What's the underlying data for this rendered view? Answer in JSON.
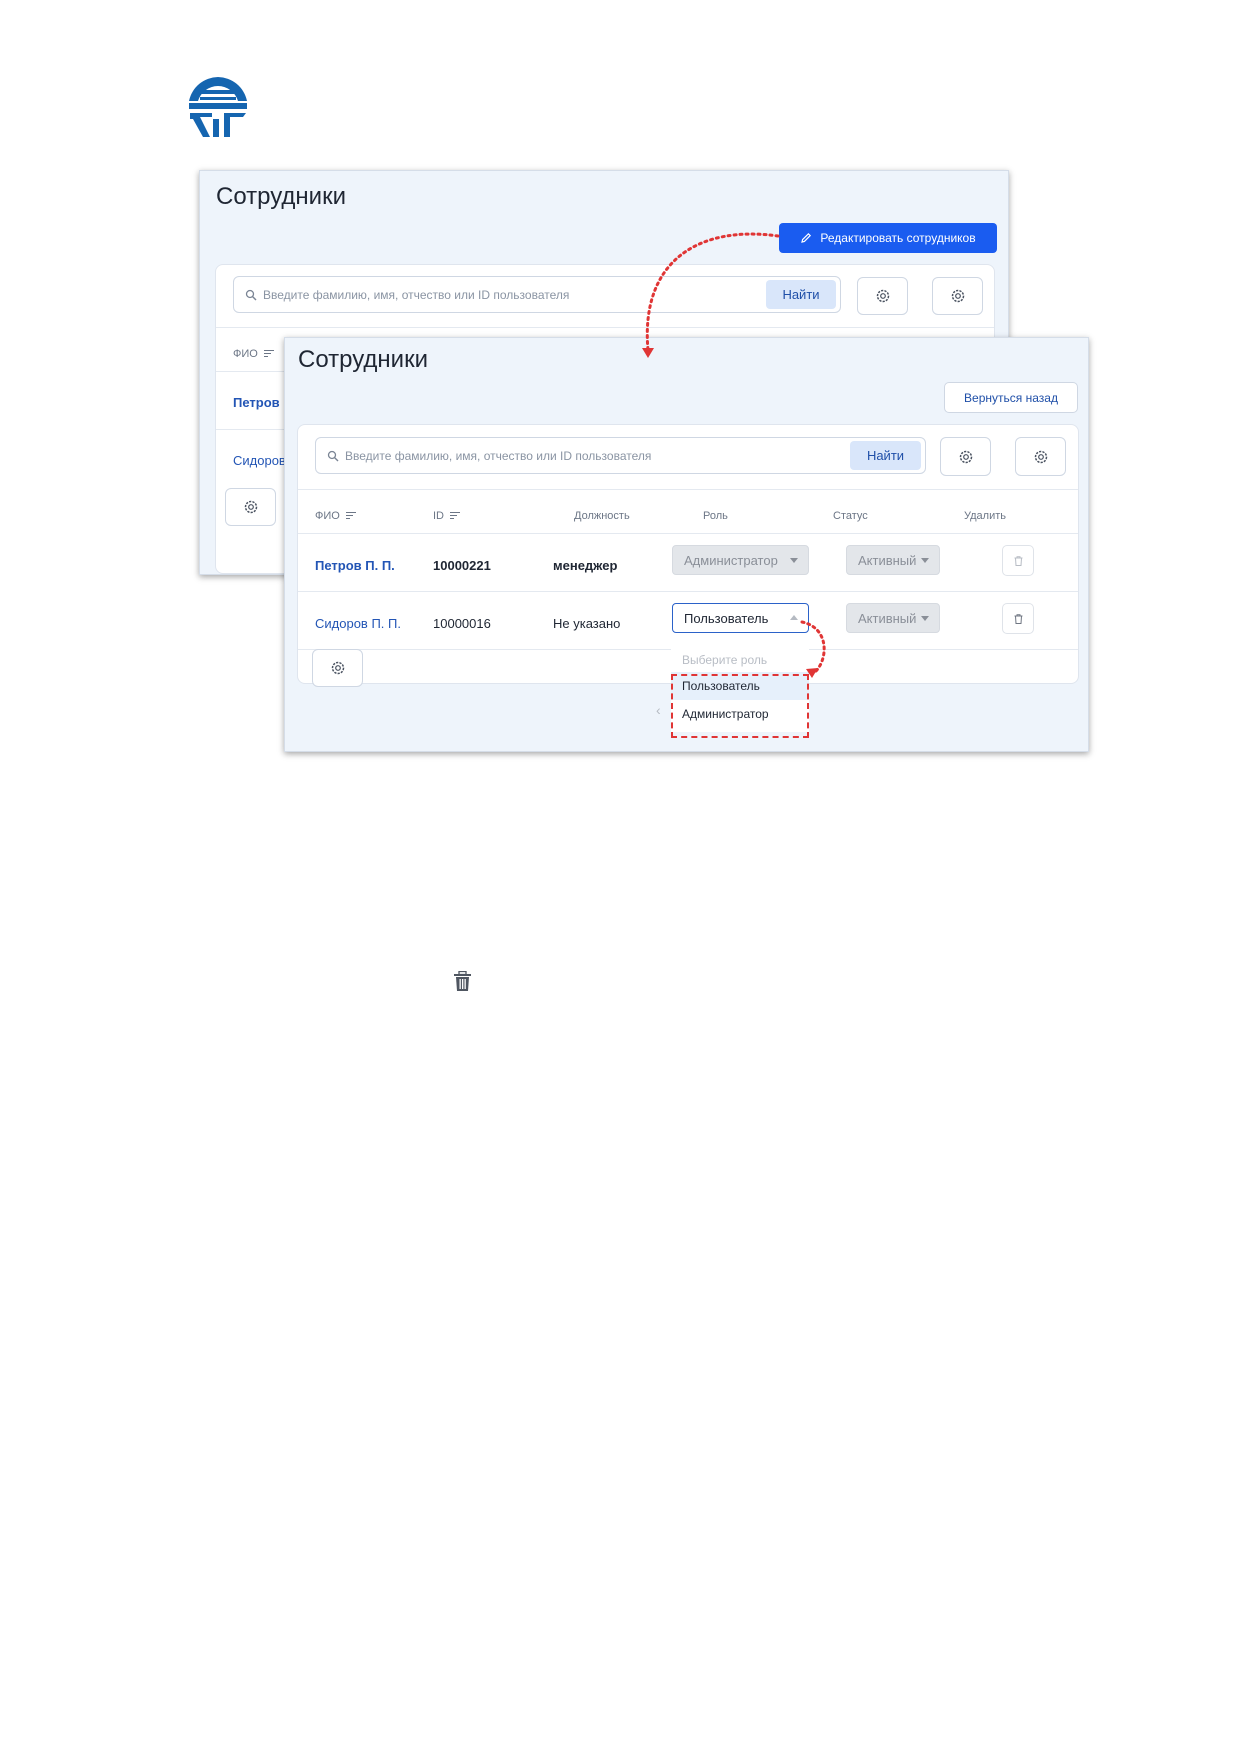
{
  "colors": {
    "accent": "#1a5cf0",
    "logo": "#1565b0",
    "annotation": "#e03535",
    "panel_bg": "#eef4fb"
  },
  "logo": {
    "icon": "company-logo"
  },
  "back_panel": {
    "title": "Сотрудники",
    "edit_button": "Редактировать сотрудников",
    "search_placeholder": "Введите фамилию, имя, отчество или ID пользователя",
    "find_button": "Найти",
    "column_fio": "ФИО",
    "rows": [
      "Петров П",
      "Сидоров"
    ]
  },
  "front_panel": {
    "title": "Сотрудники",
    "back_button": "Вернуться назад",
    "search_placeholder": "Введите фамилию, имя, отчество или ID пользователя",
    "find_button": "Найти",
    "columns": {
      "fio": "ФИО",
      "id": "ID",
      "position": "Должность",
      "role": "Роль",
      "status": "Статус",
      "delete": "Удалить"
    },
    "rows": [
      {
        "name": "Петров П. П.",
        "id": "10000221",
        "position": "менеджер",
        "role": "Администратор",
        "status": "Активный"
      },
      {
        "name": "Сидоров П. П.",
        "id": "10000016",
        "position": "Не указано",
        "role": "Пользователь",
        "status": "Активный"
      }
    ],
    "dropdown": {
      "placeholder": "Выберите роль",
      "options": [
        "Пользователь",
        "Администратор"
      ],
      "highlighted": "Пользователь"
    },
    "pagination_prev": "‹"
  },
  "standalone_icon": "trash-icon"
}
